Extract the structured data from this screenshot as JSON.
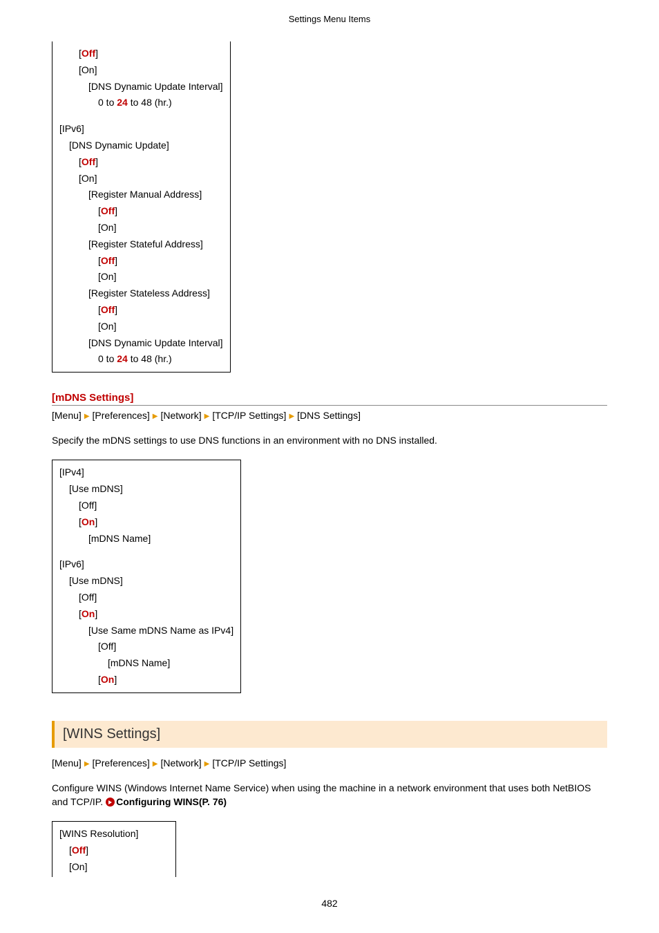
{
  "running_head": "Settings Menu Items",
  "box1": {
    "off": "Off",
    "on": "On",
    "interval_label": "DNS Dynamic Update Interval",
    "interval_pre": "0 to ",
    "interval_def": "24",
    "interval_post": " to 48 (hr.)",
    "ipv6": "IPv6",
    "dyn_upd": "DNS Dynamic Update",
    "reg_manual": "Register Manual Address",
    "reg_stateful": "Register Stateful Address",
    "reg_stateless": "Register Stateless Address"
  },
  "mdns": {
    "heading": "[mDNS Settings]",
    "bc": [
      "[Menu]",
      "[Preferences]",
      "[Network]",
      "[TCP/IP Settings]",
      "[DNS Settings]"
    ],
    "desc": "Specify the mDNS settings to use DNS functions in an environment with no DNS installed."
  },
  "box2": {
    "ipv4": "IPv4",
    "ipv6": "IPv6",
    "use_mdns": "Use mDNS",
    "off": "Off",
    "on": "On",
    "mdns_name": "mDNS Name",
    "use_same": "Use Same mDNS Name as IPv4"
  },
  "wins": {
    "heading": "[WINS Settings]",
    "bc": [
      "[Menu]",
      "[Preferences]",
      "[Network]",
      "[TCP/IP Settings]"
    ],
    "desc_pre": "Configure WINS (Windows Internet Name Service) when using the machine in a network environment that uses both NetBIOS and TCP/IP. ",
    "link": "Configuring WINS(P. 76)"
  },
  "box3": {
    "resolution": "WINS Resolution",
    "off": "Off",
    "on": "On"
  },
  "pagenum": "482"
}
